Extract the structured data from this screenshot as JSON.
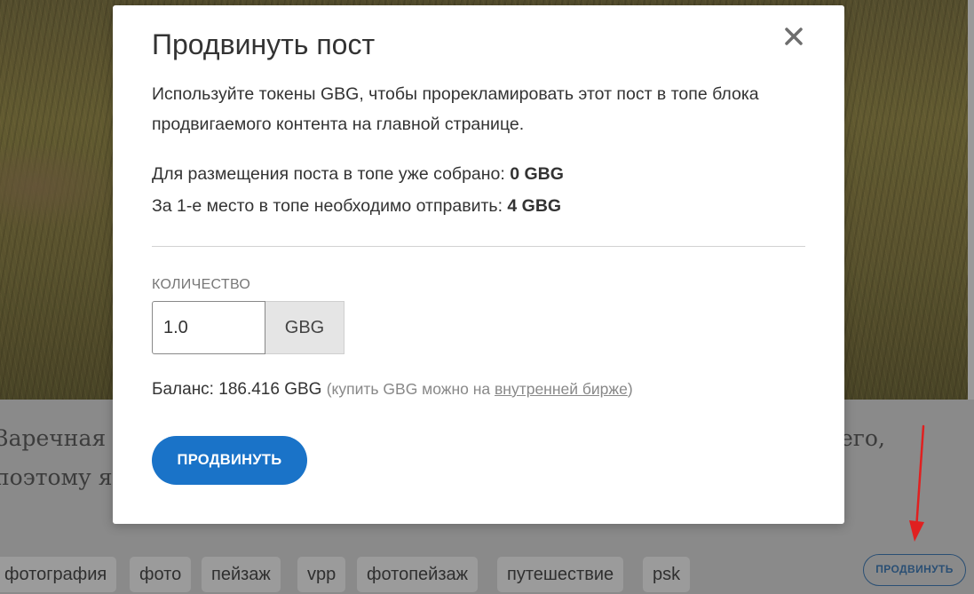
{
  "background": {
    "text_line_1_left": "Заречная с",
    "text_line_1_right": "его,",
    "text_line_2_left": "поэтому я",
    "tags": [
      "фотография",
      "фото",
      "пейзаж",
      "vpp",
      "фотопейзаж",
      "путешествие",
      "psk"
    ],
    "promote_button_label": "ПРОДВИНУТЬ"
  },
  "modal": {
    "title": "Продвинуть пост",
    "description": "Используйте токены GBG, чтобы прорекламировать этот пост в топе блока продвигаемого контента на главной странице.",
    "collected_label": "Для размещения поста в топе уже собрано:",
    "collected_value": "0 GBG",
    "first_place_label": "За 1-е место в топе необходимо отправить:",
    "first_place_value": "4 GBG",
    "quantity_label": "КОЛИЧЕСТВО",
    "quantity_value": "1.0",
    "quantity_unit": "GBG",
    "balance_label": "Баланс:",
    "balance_value": "186.416 GBG",
    "balance_hint_prefix": "(купить GBG можно на",
    "balance_hint_link": "внутренней бирже",
    "balance_hint_suffix": ")",
    "submit_label": "ПРОДВИНУТЬ",
    "close_icon": "close-icon"
  },
  "colors": {
    "primary_button": "#1a73c8",
    "overlay": "#8a8a8a",
    "annotation_arrow": "#e02020"
  }
}
